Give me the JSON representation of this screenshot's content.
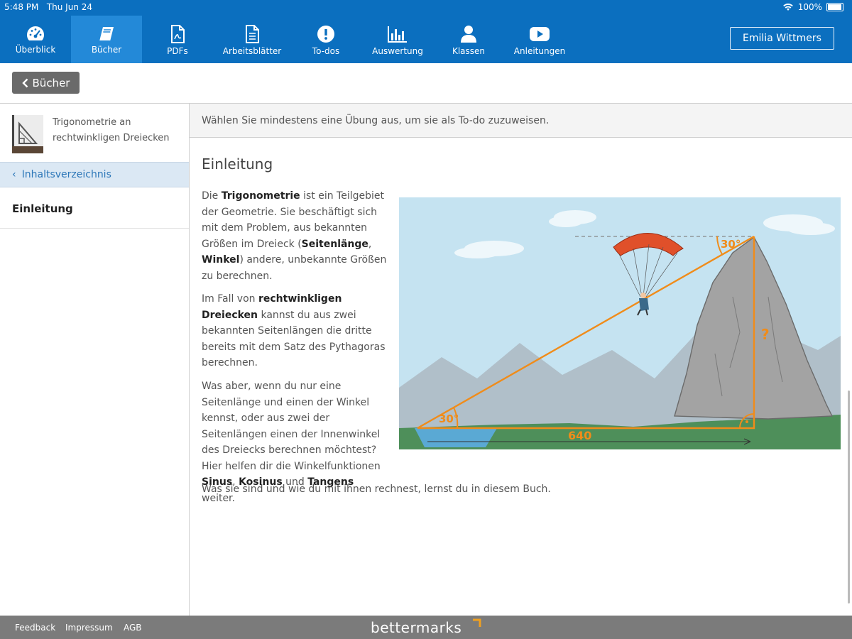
{
  "statusbar": {
    "time": "5:48 PM",
    "date": "Thu Jun 24",
    "battery": "100%"
  },
  "nav": {
    "items": [
      {
        "label": "Überblick",
        "icon": "dashboard-icon"
      },
      {
        "label": "Bücher",
        "icon": "book-icon"
      },
      {
        "label": "PDFs",
        "icon": "pdf-icon"
      },
      {
        "label": "Arbeitsblätter",
        "icon": "worksheet-icon"
      },
      {
        "label": "To-dos",
        "icon": "alert-icon"
      },
      {
        "label": "Auswertung",
        "icon": "bar-chart-icon"
      },
      {
        "label": "Klassen",
        "icon": "person-icon"
      },
      {
        "label": "Anleitungen",
        "icon": "video-icon"
      }
    ],
    "active": "Bücher",
    "user": "Emilia Wittmers"
  },
  "subheader": {
    "back_label": "Bücher"
  },
  "sidebar": {
    "book_title": "Trigonometrie an rechtwinkligen Dreiecken",
    "toc_label": "Inhaltsverzeichnis",
    "current_item": "Einleitung"
  },
  "hint": "Wählen Sie mindestens eine Übung aus, um sie als To-do zuzuweisen.",
  "content": {
    "heading": "Einleitung",
    "p1": {
      "t1": "Die ",
      "b1": "Trigonometrie",
      "t2": " ist ein Teilgebiet der Geometrie. Sie beschäftigt sich mit dem Problem, aus bekannten Größen im Dreieck (",
      "b2": "Seitenlänge",
      "t3": ", ",
      "b3": "Winkel",
      "t4": ") andere, unbekannte Größen zu berechnen."
    },
    "p2": {
      "t1": "Im Fall von ",
      "b1": "rechtwinkligen Dreiecken",
      "t2": " kannst du aus zwei bekannten Seitenlängen die dritte bereits mit dem Satz des Pythagoras berechnen."
    },
    "p3": {
      "t1": "Was aber, wenn du nur eine Seitenlänge und einen der Winkel kennst, oder aus zwei der Seitenlängen einen der Innenwinkel des Dreiecks berechnen möchtest? Hier helfen dir die Winkelfunktionen ",
      "b1": "Sinus",
      "t2": ", ",
      "b2": "Kosinus",
      "t3": " und ",
      "b3": "Tangens",
      "t4": " weiter."
    },
    "p4": "Was sie sind und wie du mit ihnen rechnest, lernst du in diesem Buch.",
    "illustration": {
      "angle_top": "30°",
      "angle_bottom": "30°",
      "base_length": "640",
      "unknown": "?"
    }
  },
  "footer": {
    "links": [
      "Feedback",
      "Impressum",
      "AGB"
    ],
    "brand": "bettermarks"
  },
  "colors": {
    "nav_bg": "#0b6fbf",
    "nav_active": "#2389d8",
    "accent_orange": "#f08c1a",
    "footer_bg": "#7b7b7b"
  }
}
